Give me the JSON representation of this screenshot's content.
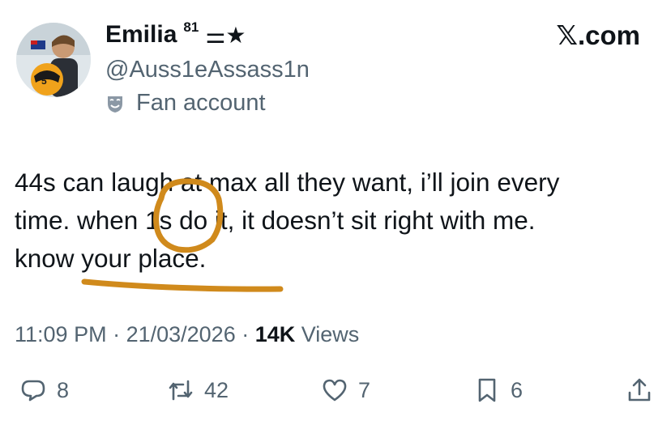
{
  "author": {
    "display_name": "Emilia",
    "badge": "81",
    "emoji": "⚌★",
    "handle": "@Auss1eAssass1n",
    "label": "Fan account"
  },
  "brand": "𝕏.com",
  "tweet": {
    "line1": "44s can laugh at max all they want, i’ll join every",
    "line2": "time. when 1s do it, it doesn’t sit right with me.",
    "line3": "know your place."
  },
  "meta": {
    "time": "11:09 PM",
    "separator": " · ",
    "date": "21/03/2026",
    "views_count": "14K",
    "views_label": "Views"
  },
  "actions": {
    "replies": "8",
    "reposts": "42",
    "likes": "7",
    "bookmarks": "6"
  },
  "colors": {
    "annotation": "#d08a1c",
    "secondary_text": "#536471",
    "primary_text": "#0f1419"
  },
  "icons": [
    "reply-icon",
    "repost-icon",
    "like-icon",
    "bookmark-icon",
    "share-icon",
    "fan-label-icon"
  ]
}
